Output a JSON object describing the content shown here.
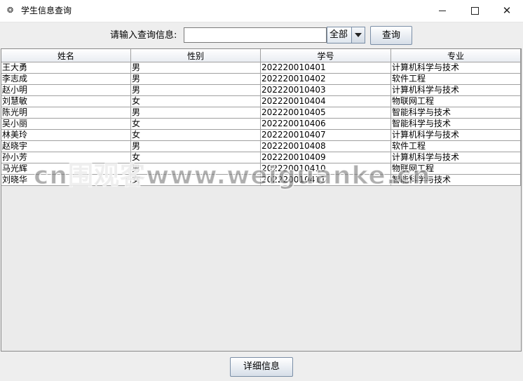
{
  "window": {
    "title": "学生信息查询",
    "icon": "java-app-icon"
  },
  "search": {
    "label": "请输入查询信息:",
    "value": "",
    "placeholder": "",
    "filter_selected": "全部",
    "query_label": "查询"
  },
  "table": {
    "columns": [
      "姓名",
      "性别",
      "学号",
      "专业"
    ],
    "rows": [
      [
        "王大勇",
        "男",
        "202220010401",
        "计算机科学与技术"
      ],
      [
        "李志成",
        "男",
        "202220010402",
        "软件工程"
      ],
      [
        "赵小明",
        "男",
        "202220010403",
        "计算机科学与技术"
      ],
      [
        "刘慧敏",
        "女",
        "202220010404",
        "物联网工程"
      ],
      [
        "陈光明",
        "男",
        "202220010405",
        "智能科学与技术"
      ],
      [
        "吴小丽",
        "女",
        "202220010406",
        "智能科学与技术"
      ],
      [
        "林美玲",
        "女",
        "202220010407",
        "计算机科学与技术"
      ],
      [
        "赵晓宇",
        "男",
        "202220010408",
        "软件工程"
      ],
      [
        "孙小芳",
        "女",
        "202220010409",
        "计算机科学与技术"
      ],
      [
        "马光辉",
        "男",
        "202220010410",
        "物联网工程"
      ],
      [
        "刘晓华",
        "女",
        "202220010411",
        "智能科学与技术"
      ]
    ]
  },
  "footer": {
    "detail_label": "详细信息"
  },
  "watermark": "cn围观客www.weiguanke.cn"
}
